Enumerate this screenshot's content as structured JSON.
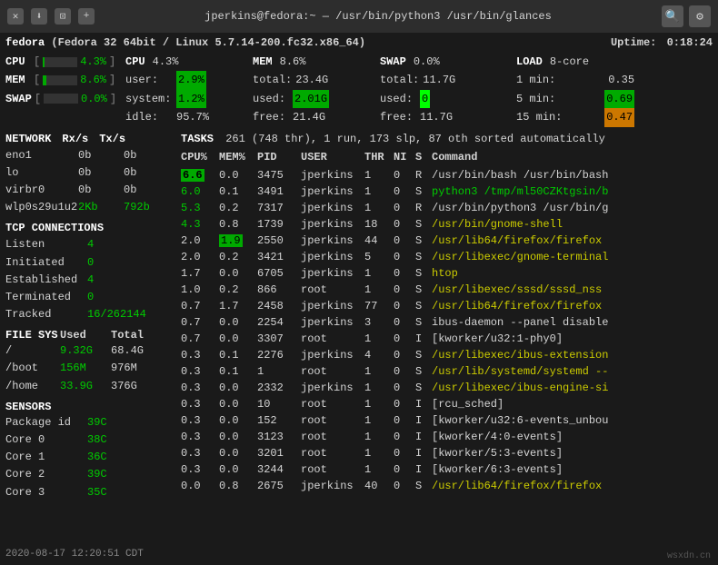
{
  "titlebar": {
    "title": "jperkins@fedora:~ — /usr/bin/python3 /usr/bin/glances",
    "btn_close": "✕",
    "btn_min": "⬇",
    "btn_max": "⊡",
    "btn_new": "+",
    "icon_search": "🔍",
    "icon_gear": "⚙"
  },
  "sysinfo": {
    "host": "fedora",
    "desc": "(Fedora 32 64bit / Linux 5.7.14-200.fc32.x86_64)",
    "uptime_label": "Uptime:",
    "uptime_val": "0:18:24"
  },
  "cpu_mini": {
    "label": "CPU",
    "val": "4.3%",
    "bar_pct": 4.3
  },
  "mem_mini": {
    "label": "MEM",
    "val": "8.6%",
    "bar_pct": 8.6
  },
  "swap_mini": {
    "label": "SWAP",
    "val": "0.0%",
    "bar_pct": 0
  },
  "cpu_detail": {
    "header": "CPU",
    "pct": "4.3%",
    "user_label": "user:",
    "user_val": "2.9%",
    "system_label": "system:",
    "system_val": "1.2%",
    "idle_label": "idle:",
    "idle_val": "95.7%"
  },
  "mem_detail": {
    "header": "MEM",
    "pct": "8.6%",
    "total_label": "total:",
    "total_val": "23.4G",
    "used_label": "used:",
    "used_val": "2.01G",
    "free_label": "free:",
    "free_val": "21.4G"
  },
  "swap_detail": {
    "header": "SWAP",
    "pct": "0.0%",
    "total_label": "total:",
    "total_val": "11.7G",
    "used_label": "used:",
    "used_val": "0",
    "free_label": "free:",
    "free_val": "11.7G"
  },
  "load": {
    "header": "LOAD",
    "cores": "8-core",
    "min1_label": "1 min:",
    "min1_val": "0.35",
    "min5_label": "5 min:",
    "min5_val": "0.69",
    "min15_label": "15 min:",
    "min15_val": "0.47"
  },
  "network": {
    "header": "NETWORK",
    "rx_label": "Rx/s",
    "tx_label": "Tx/s",
    "ifaces": [
      {
        "name": "eno1",
        "rx": "0b",
        "tx": "0b"
      },
      {
        "name": "lo",
        "rx": "0b",
        "tx": "0b"
      },
      {
        "name": "virbr0",
        "rx": "0b",
        "tx": "0b"
      },
      {
        "name": "wlp0s29u1u2",
        "rx": "2Kb",
        "tx": "792b"
      }
    ]
  },
  "tasks": {
    "header": "TASKS",
    "summary": "261 (748 thr), 1 run, 173 slp, 87 oth sorted automatically"
  },
  "tcp": {
    "header": "TCP CONNECTIONS",
    "rows": [
      {
        "label": "Listen",
        "val": "4"
      },
      {
        "label": "Initiated",
        "val": "0"
      },
      {
        "label": "Established",
        "val": "4"
      },
      {
        "label": "Terminated",
        "val": "0"
      },
      {
        "label": "Tracked",
        "val": "16/262144"
      }
    ]
  },
  "filesys": {
    "header": "FILE SYS",
    "col_used": "Used",
    "col_total": "Total",
    "rows": [
      {
        "path": "/",
        "used": "9.32G",
        "total": "68.4G"
      },
      {
        "path": "/boot",
        "used": "156M",
        "total": "976M"
      },
      {
        "path": "/home",
        "used": "33.9G",
        "total": "376G"
      }
    ]
  },
  "sensors": {
    "header": "SENSORS",
    "rows": [
      {
        "label": "Package id",
        "val": "39C"
      },
      {
        "label": "Core 0",
        "val": "38C"
      },
      {
        "label": "Core 1",
        "val": "36C"
      },
      {
        "label": "Core 2",
        "val": "39C"
      },
      {
        "label": "Core 3",
        "val": "35C"
      }
    ]
  },
  "processes": {
    "col_cpu": "CPU%",
    "col_mem": "MEM%",
    "col_pid": "PID",
    "col_user": "USER",
    "col_thr": "THR",
    "col_ni": "NI",
    "col_s": "S",
    "col_cmd": "Command",
    "rows": [
      {
        "cpu": "6.6",
        "mem": "0.0",
        "pid": "3475",
        "user": "jperkins",
        "thr": "1",
        "ni": "0",
        "s": "R",
        "cmd": "/usr/bin/bash /usr/bin/bash",
        "cpu_class": "high",
        "cmd_color": "white"
      },
      {
        "cpu": "6.0",
        "mem": "0.1",
        "pid": "3491",
        "user": "jperkins",
        "thr": "1",
        "ni": "0",
        "s": "S",
        "cmd": "python3 /tmp/ml50CZKtgsin/b",
        "cpu_class": "med",
        "cmd_color": "green"
      },
      {
        "cpu": "5.3",
        "mem": "0.2",
        "pid": "7317",
        "user": "jperkins",
        "thr": "1",
        "ni": "0",
        "s": "R",
        "cmd": "/usr/bin/python3 /usr/bin/g",
        "cpu_class": "med",
        "cmd_color": "white"
      },
      {
        "cpu": "4.3",
        "mem": "0.8",
        "pid": "1739",
        "user": "jperkins",
        "thr": "18",
        "ni": "0",
        "s": "S",
        "cmd": "/usr/bin/gnome-shell",
        "cpu_class": "med",
        "cmd_color": "yellow"
      },
      {
        "cpu": "2.0",
        "mem": "1.9",
        "pid": "2550",
        "user": "jperkins",
        "thr": "44",
        "ni": "0",
        "s": "S",
        "cmd": "/usr/lib64/firefox/firefox",
        "cpu_class": "low",
        "cmd_color": "yellow"
      },
      {
        "cpu": "2.0",
        "mem": "0.2",
        "pid": "3421",
        "user": "jperkins",
        "thr": "5",
        "ni": "0",
        "s": "S",
        "cmd": "/usr/libexec/gnome-terminal",
        "cpu_class": "low",
        "cmd_color": "yellow"
      },
      {
        "cpu": "1.7",
        "mem": "0.0",
        "pid": "6705",
        "user": "jperkins",
        "thr": "1",
        "ni": "0",
        "s": "S",
        "cmd": "htop",
        "cpu_class": "low",
        "cmd_color": "yellow"
      },
      {
        "cpu": "1.0",
        "mem": "0.2",
        "pid": "866",
        "user": "root",
        "thr": "1",
        "ni": "0",
        "s": "S",
        "cmd": "/usr/libexec/sssd/sssd_nss",
        "cpu_class": "low",
        "cmd_color": "yellow"
      },
      {
        "cpu": "0.7",
        "mem": "1.7",
        "pid": "2458",
        "user": "jperkins",
        "thr": "77",
        "ni": "0",
        "s": "S",
        "cmd": "/usr/lib64/firefox/firefox",
        "cpu_class": "low",
        "cmd_color": "yellow"
      },
      {
        "cpu": "0.7",
        "mem": "0.0",
        "pid": "2254",
        "user": "jperkins",
        "thr": "3",
        "ni": "0",
        "s": "S",
        "cmd": "ibus-daemon --panel disable",
        "cpu_class": "low",
        "cmd_color": "white"
      },
      {
        "cpu": "0.7",
        "mem": "0.0",
        "pid": "3307",
        "user": "root",
        "thr": "1",
        "ni": "0",
        "s": "I",
        "cmd": "[kworker/u32:1-phy0]",
        "cpu_class": "low",
        "cmd_color": "white"
      },
      {
        "cpu": "0.3",
        "mem": "0.1",
        "pid": "2276",
        "user": "jperkins",
        "thr": "4",
        "ni": "0",
        "s": "S",
        "cmd": "/usr/libexec/ibus-extension",
        "cpu_class": "low",
        "cmd_color": "yellow"
      },
      {
        "cpu": "0.3",
        "mem": "0.1",
        "pid": "1",
        "user": "root",
        "thr": "1",
        "ni": "0",
        "s": "S",
        "cmd": "/usr/lib/systemd/systemd --",
        "cpu_class": "low",
        "cmd_color": "yellow"
      },
      {
        "cpu": "0.3",
        "mem": "0.0",
        "pid": "2332",
        "user": "jperkins",
        "thr": "1",
        "ni": "0",
        "s": "S",
        "cmd": "/usr/libexec/ibus-engine-si",
        "cpu_class": "low",
        "cmd_color": "yellow"
      },
      {
        "cpu": "0.3",
        "mem": "0.0",
        "pid": "10",
        "user": "root",
        "thr": "1",
        "ni": "0",
        "s": "I",
        "cmd": "[rcu_sched]",
        "cpu_class": "low",
        "cmd_color": "white"
      },
      {
        "cpu": "0.3",
        "mem": "0.0",
        "pid": "152",
        "user": "root",
        "thr": "1",
        "ni": "0",
        "s": "I",
        "cmd": "[kworker/u32:6-events_unbou",
        "cpu_class": "low",
        "cmd_color": "white"
      },
      {
        "cpu": "0.3",
        "mem": "0.0",
        "pid": "3123",
        "user": "root",
        "thr": "1",
        "ni": "0",
        "s": "I",
        "cmd": "[kworker/4:0-events]",
        "cpu_class": "low",
        "cmd_color": "white"
      },
      {
        "cpu": "0.3",
        "mem": "0.0",
        "pid": "3201",
        "user": "root",
        "thr": "1",
        "ni": "0",
        "s": "I",
        "cmd": "[kworker/5:3-events]",
        "cpu_class": "low",
        "cmd_color": "white"
      },
      {
        "cpu": "0.3",
        "mem": "0.0",
        "pid": "3244",
        "user": "root",
        "thr": "1",
        "ni": "0",
        "s": "I",
        "cmd": "[kworker/6:3-events]",
        "cpu_class": "low",
        "cmd_color": "white"
      },
      {
        "cpu": "0.0",
        "mem": "0.8",
        "pid": "2675",
        "user": "jperkins",
        "thr": "40",
        "ni": "0",
        "s": "S",
        "cmd": "/usr/lib64/firefox/firefox",
        "cpu_class": "low",
        "cmd_color": "yellow"
      }
    ]
  },
  "timestamp": "2020-08-17 12:20:51 CDT",
  "watermark": "wsxdn.cn"
}
